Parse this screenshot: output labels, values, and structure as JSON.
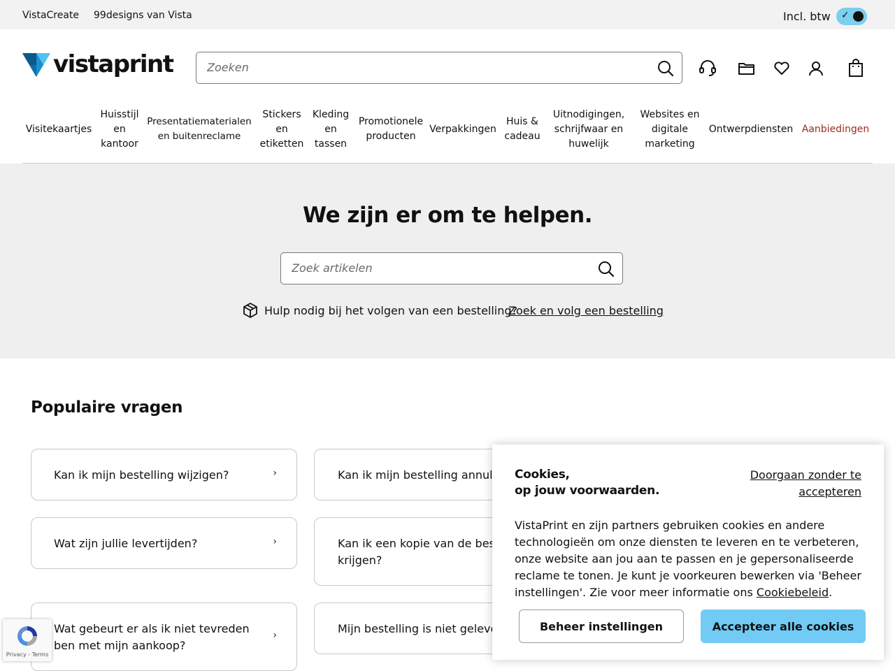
{
  "topbar": {
    "link1": "VistaCreate",
    "link2": "99designs van Vista",
    "vat_label": "Incl. btw",
    "vat_toggle_on": true
  },
  "header": {
    "logo_text": "vistaprint",
    "logo_reg": "®",
    "search_placeholder": "Zoeken",
    "icons": [
      "headset-icon",
      "folder-icon",
      "heart-icon",
      "account-icon",
      "cart-icon"
    ]
  },
  "nav": {
    "items": [
      "Visitekaartjes",
      "Huisstijl\nen\nkantoor",
      "Presentatiematerialen\nen buitenreclame",
      "Stickers\nen\netiketten",
      "Kleding\nen\ntassen",
      "Promotionele\nproducten",
      "Verpakkingen",
      "Huis &\ncadeau",
      "Uitnodigingen,\nschrijfwaar en\nhuwelijk",
      "Websites en\ndigitale\nmarketing",
      "Ontwerpdiensten",
      "Aanbiedingen"
    ],
    "accent_color": "#9c2b23"
  },
  "hero": {
    "title": "We zijn er om te helpen.",
    "search_placeholder": "Zoek artikelen",
    "track_question": "Hulp nodig bij het volgen van een bestelling?",
    "track_link": "Zoek en volg een bestelling"
  },
  "popular": {
    "title": "Populaire vragen",
    "questions": [
      "Kan ik mijn bestelling wijzigen?",
      "Kan ik mijn bestelling annuleren?",
      "Wat zijn jullie levertijden?",
      "Kan ik een kopie van de bestelling krijgen?",
      "Wat gebeurt er als ik niet tevreden ben met mijn aankoop?",
      "Mijn bestelling is niet geleverd"
    ]
  },
  "cookies": {
    "title_line1": "Cookies,",
    "title_line2": "op jouw voorwaarden.",
    "skip_link": "Doorgaan zonder te accepteren",
    "body_text": "VistaPrint en zijn partners gebruiken cookies en andere technologieën om onze diensten te leveren en te verbeteren, onze website aan jou aan te passen en je gepersonaliseerde reclame te tonen. Je kunt je voorkeuren bewerken via 'Beheer instellingen'. Zie voor meer informatie ons ",
    "policy_link": "Cookiebeleid",
    "body_end": ".",
    "manage_button": "Beheer instellingen",
    "accept_button": "Accepteer alle cookies",
    "accept_color": "#71cbf4"
  },
  "recaptcha": {
    "links": "Privacy - Terms"
  }
}
